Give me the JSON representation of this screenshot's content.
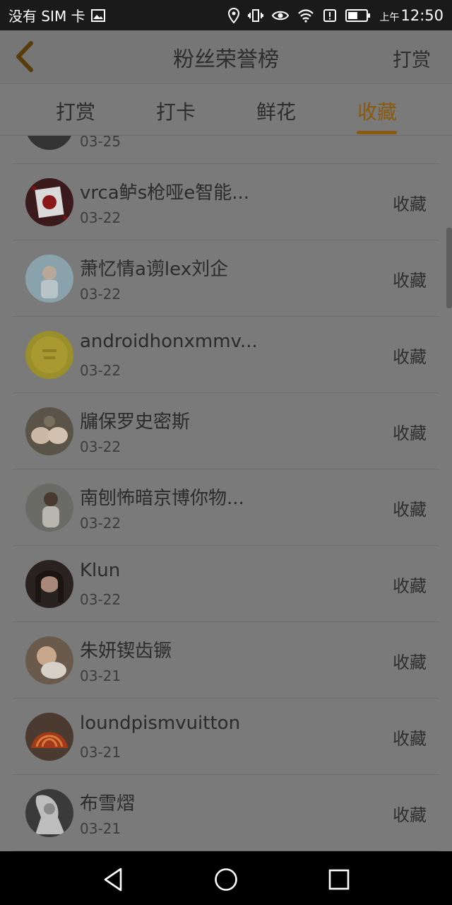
{
  "status_bar": {
    "carrier": "没有 SIM 卡",
    "time_prefix": "上午",
    "time": "12:50"
  },
  "header": {
    "title": "粉丝荣誉榜",
    "action_label": "打赏"
  },
  "tabs": [
    {
      "label": "打赏",
      "active": false
    },
    {
      "label": "打卡",
      "active": false
    },
    {
      "label": "鲜花",
      "active": false
    },
    {
      "label": "收藏",
      "active": true
    }
  ],
  "list": {
    "partial_top": {
      "date": "03-25"
    },
    "items": [
      {
        "name": "vrca鲈s枪哑e智能...",
        "date": "03-22",
        "action": "收藏"
      },
      {
        "name": "萧忆情a谫lex刘企",
        "date": "03-22",
        "action": "收藏"
      },
      {
        "name": "androidhonxmmv...",
        "date": "03-22",
        "action": "收藏"
      },
      {
        "name": "牖保罗史密斯",
        "date": "03-22",
        "action": "收藏"
      },
      {
        "name": "南刨怖暗京博你物...",
        "date": "03-22",
        "action": "收藏"
      },
      {
        "name": "Klun",
        "date": "03-22",
        "action": "收藏"
      },
      {
        "name": "朱妍锲齿镢",
        "date": "03-21",
        "action": "收藏"
      },
      {
        "name": "loundpismvuitton",
        "date": "03-21",
        "action": "收藏"
      },
      {
        "name": "布雪熠",
        "date": "03-21",
        "action": "收藏"
      }
    ]
  },
  "colors": {
    "accent": "#8a5a0f",
    "overlay_bg": "#7a7a7a",
    "status_bg": "#1a1a1a",
    "nav_bg": "#000000"
  }
}
